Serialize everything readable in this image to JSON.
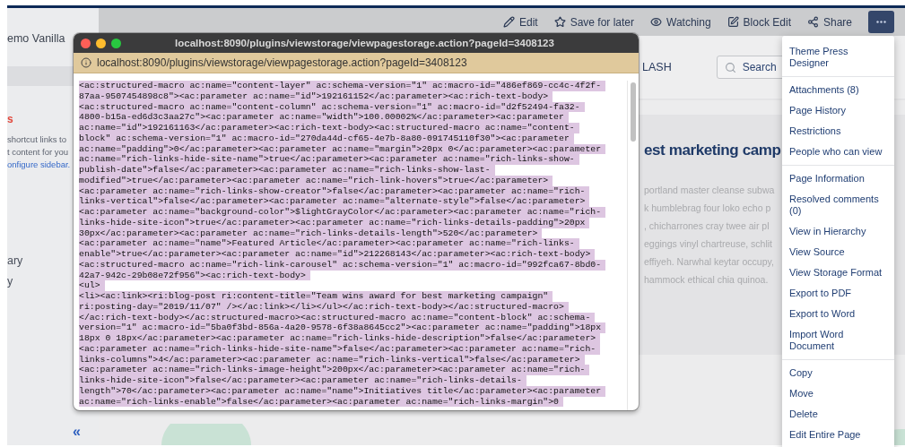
{
  "sidebar": {
    "space_name": "emo Vanilla",
    "heading": "s",
    "text_lines": [
      "shortcut links to",
      "t content for you"
    ],
    "link": "onfigure sidebar.",
    "items": [
      "ary",
      "y"
    ],
    "collapse": "«"
  },
  "toolbar": [
    {
      "label": "Edit",
      "kind": "pencil"
    },
    {
      "label": "Save for later",
      "kind": "star"
    },
    {
      "label": "Watching",
      "kind": "eye"
    },
    {
      "label": "Block Edit",
      "kind": "edit-box"
    },
    {
      "label": "Share",
      "kind": "share"
    }
  ],
  "header": {
    "nav_label": "LASH",
    "search": {
      "placeholder": "Search"
    }
  },
  "article": {
    "title": "est marketing camp",
    "lines": [
      "portland master cleanse subwa",
      "k humblebrag four loko echo p",
      ", chicharrones cray twee air pl",
      "eggings vinyl chartreuse, schlit",
      "effiyeh. Narwhal keytar occupy,",
      "hammock ethical chia quinoa."
    ]
  },
  "popup": {
    "title": "localhost:8090/plugins/viewstorage/viewpagestorage.action?pageId=3408123",
    "address": "localhost:8090/plugins/viewstorage/viewpagestorage.action?pageId=3408123",
    "lines": [
      "<ac:structured-macro ac:name=\"content-layer\" ac:schema-version=\"1\" ac:macro-id=\"486ef869-cc4c-4f2f-",
      "87aa-9507454898c8\"><ac:parameter ac:name=\"id\">192161152</ac:parameter><ac:rich-text-body>",
      "<ac:structured-macro ac:name=\"content-column\" ac:schema-version=\"1\" ac:macro-id=\"d2f52494-fa32-",
      "4800-b15a-ed6d3c3aa27c\"><ac:parameter ac:name=\"width\">100.00002%</ac:parameter><ac:parameter",
      "ac:name=\"id\">192161163</ac:parameter><ac:rich-text-body><ac:structured-macro ac:name=\"content-",
      "block\" ac:schema-version=\"1\" ac:macro-id=\"270da44d-cf65-4e7b-8a80-091745110f30\"><ac:parameter",
      "ac:name=\"padding\">0</ac:parameter><ac:parameter ac:name=\"margin\">20px 0</ac:parameter><ac:parameter",
      "ac:name=\"rich-links-hide-site-name\">true</ac:parameter><ac:parameter ac:name=\"rich-links-show-",
      "publish-date\">false</ac:parameter><ac:parameter ac:name=\"rich-links-show-last-",
      "modified\">true</ac:parameter><ac:parameter ac:name=\"rich-link-hovers\">true</ac:parameter>",
      "<ac:parameter ac:name=\"rich-links-show-creator\">false</ac:parameter><ac:parameter ac:name=\"rich-",
      "links-vertical\">false</ac:parameter><ac:parameter ac:name=\"alternate-style\">false</ac:parameter>",
      "<ac:parameter ac:name=\"background-color\">$lightGrayColor</ac:parameter><ac:parameter ac:name=\"rich-",
      "links-hide-site-icon\">true</ac:parameter><ac:parameter ac:name=\"rich-links-details-padding\">20px",
      "30px</ac:parameter><ac:parameter ac:name=\"rich-links-details-length\">520</ac:parameter>",
      "<ac:parameter ac:name=\"name\">Featured Article</ac:parameter><ac:parameter ac:name=\"rich-links-",
      "enable\">true</ac:parameter><ac:parameter ac:name=\"id\">212268143</ac:parameter><ac:rich-text-body>",
      "<ac:structured-macro ac:name=\"rich-link-carousel\" ac:schema-version=\"1\" ac:macro-id=\"992fca67-8bd0-",
      "42a7-942c-29b08e72f956\"><ac:rich-text-body>",
      "<ul>",
      "<li><ac:link><ri:blog-post ri:content-title=\"Team wins award for best marketing campaign\"",
      "ri:posting-day=\"2019/11/07\" /></ac:link></li></ul></ac:rich-text-body></ac:structured-macro>",
      "</ac:rich-text-body></ac:structured-macro><ac:structured-macro ac:name=\"content-block\" ac:schema-",
      "version=\"1\" ac:macro-id=\"5ba0f3bd-856a-4a20-9578-6f38a8645cc2\"><ac:parameter ac:name=\"padding\">18px",
      "18px 0 18px</ac:parameter><ac:parameter ac:name=\"rich-links-hide-description\">false</ac:parameter>",
      "<ac:parameter ac:name=\"rich-links-hide-site-name\">false</ac:parameter><ac:parameter ac:name=\"rich-",
      "links-columns\">4</ac:parameter><ac:parameter ac:name=\"rich-links-vertical\">false</ac:parameter>",
      "<ac:parameter ac:name=\"rich-links-image-height\">200px</ac:parameter><ac:parameter ac:name=\"rich-",
      "links-hide-site-icon\">false</ac:parameter><ac:parameter ac:name=\"rich-links-details-",
      "length\">70</ac:parameter><ac:parameter ac:name=\"name\">Initiatives title</ac:parameter><ac:parameter",
      "ac:name=\"rich-links-enable\">false</ac:parameter><ac:parameter ac:name=\"rich-links-margin\">0"
    ]
  },
  "menu": {
    "groups": [
      [
        "Theme Press Designer"
      ],
      [
        "Attachments (8)",
        "Page History",
        "Restrictions",
        "People who can view"
      ],
      [
        "Page Information",
        "Resolved comments (0)",
        "View in Hierarchy",
        "View Source",
        "View Storage Format",
        "Export to PDF",
        "Export to Word",
        "Import Word Document"
      ],
      [
        "Copy",
        "Move",
        "Delete",
        "Edit Entire Page"
      ]
    ]
  }
}
